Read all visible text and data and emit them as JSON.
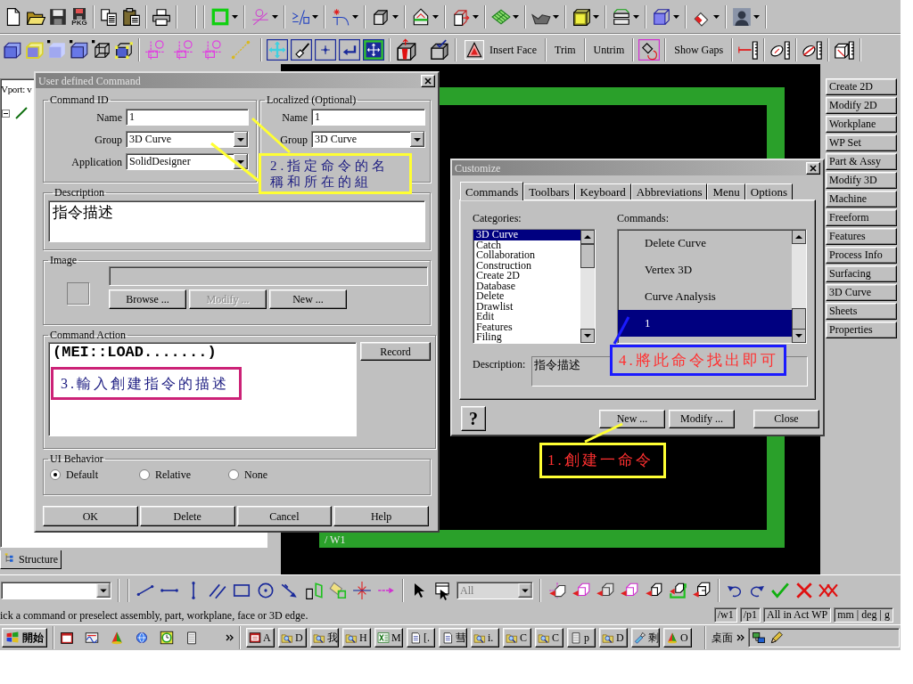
{
  "toolbar_standard": {
    "package_label": "PKG"
  },
  "toolbar_modeling": {
    "buttons": [
      {
        "label": "Insert Face"
      },
      {
        "label": "Trim"
      },
      {
        "label": "Untrim"
      },
      {
        "label": "Show Gaps"
      }
    ]
  },
  "browser": {
    "header": "Vport: v",
    "tab": "Structure"
  },
  "viewport": {
    "label": "/ W1"
  },
  "side_menu": [
    {
      "label": "Create 2D"
    },
    {
      "label": "Modify 2D"
    },
    {
      "label": "Workplane"
    },
    {
      "label": "WP Set"
    },
    {
      "label": "Part & Assy"
    },
    {
      "label": "Modify 3D"
    },
    {
      "label": "Machine"
    },
    {
      "label": "Freeform"
    },
    {
      "label": "Features"
    },
    {
      "label": "Process Info"
    },
    {
      "label": "Surfacing"
    },
    {
      "label": "3D Curve"
    },
    {
      "label": "Sheets"
    },
    {
      "label": "Properties"
    }
  ],
  "user_command_dialog": {
    "title": "User defined Command",
    "command_id": {
      "legend": "Command ID",
      "fields": [
        {
          "label": "Name",
          "value": "1",
          "kind": "text"
        },
        {
          "label": "Group",
          "value": "3D Curve",
          "kind": "combo"
        },
        {
          "label": "Application",
          "value": "SolidDesigner",
          "kind": "combo"
        }
      ]
    },
    "localized": {
      "legend": "Localized (Optional)",
      "fields": [
        {
          "label": "Name",
          "value": "1",
          "kind": "text"
        },
        {
          "label": "Group",
          "value": "3D Curve",
          "kind": "combo"
        }
      ]
    },
    "description": {
      "legend": "Description",
      "value": "指令描述"
    },
    "image": {
      "legend": "Image",
      "buttons": [
        {
          "label": "Browse ...",
          "disabled": false
        },
        {
          "label": "Modify ...",
          "disabled": true
        },
        {
          "label": "New ...",
          "disabled": false
        }
      ]
    },
    "command_action": {
      "legend": "Command Action",
      "value": "(MEI::LOAD.......)",
      "record_button": "Record"
    },
    "ui_behavior": {
      "legend": "UI Behavior",
      "options": [
        {
          "label": "Default",
          "selected": true
        },
        {
          "label": "Relative",
          "selected": false
        },
        {
          "label": "None",
          "selected": false
        }
      ]
    },
    "buttons": [
      "OK",
      "Delete",
      "Cancel",
      "Help"
    ]
  },
  "customize_dialog": {
    "title": "Customize",
    "tabs": [
      {
        "label": "Commands",
        "selected": true
      },
      {
        "label": "Toolbars",
        "selected": false
      },
      {
        "label": "Keyboard",
        "selected": false
      },
      {
        "label": "Abbreviations",
        "selected": false
      },
      {
        "label": "Menu",
        "selected": false
      },
      {
        "label": "Options",
        "selected": false
      }
    ],
    "categories": {
      "label": "Categories:",
      "items": [
        {
          "label": "3D Curve",
          "selected": true
        },
        {
          "label": "Catch",
          "selected": false
        },
        {
          "label": "Collaboration",
          "selected": false
        },
        {
          "label": "Construction",
          "selected": false
        },
        {
          "label": "Create 2D",
          "selected": false
        },
        {
          "label": "Database",
          "selected": false
        },
        {
          "label": "Delete",
          "selected": false
        },
        {
          "label": "Drawlist",
          "selected": false
        },
        {
          "label": "Edit",
          "selected": false
        },
        {
          "label": "Features",
          "selected": false
        },
        {
          "label": "Filing",
          "selected": false
        }
      ]
    },
    "commands": {
      "label": "Commands:",
      "items": [
        {
          "label": "Delete Curve",
          "selected": false
        },
        {
          "label": "Vertex 3D",
          "selected": false
        },
        {
          "label": "Curve Analysis",
          "selected": false
        },
        {
          "label": "1",
          "selected": true
        }
      ]
    },
    "description": {
      "label": "Description:",
      "value": "指令描述"
    },
    "help_button": "?",
    "buttons": [
      "New ...",
      "Modify ...",
      "Close"
    ]
  },
  "annotations": [
    {
      "text": "1.創建一命令",
      "color": "#ffff33"
    },
    {
      "text": "2.指定命令的名稱和所在的組",
      "color": "#ffff33"
    },
    {
      "text": "3.輸入創建指令的描述",
      "color": "#cc2277"
    },
    {
      "text": "4.將此命令找出即可",
      "color": "#1a1aff"
    }
  ],
  "command_toolbar": {
    "filter": {
      "value": "All",
      "disabled": true
    }
  },
  "status_bar": {
    "prompt": "ick a command or preselect assembly, part, workplane, face or 3D edge.",
    "fields": [
      "/w1",
      "/p1",
      "All in Act WP",
      "mm | deg | g"
    ]
  },
  "taskbar": {
    "start": "開始",
    "tasks": [
      {
        "label": "A"
      },
      {
        "label": "D"
      },
      {
        "label": "我"
      },
      {
        "label": "H"
      },
      {
        "label": "M"
      },
      {
        "label": "[."
      },
      {
        "label": "彗"
      },
      {
        "label": "i."
      },
      {
        "label": "C"
      },
      {
        "label": "C"
      },
      {
        "label": "p"
      },
      {
        "label": "D"
      },
      {
        "label": "剩"
      },
      {
        "label": "O"
      }
    ],
    "desktop_label": "桌面"
  }
}
